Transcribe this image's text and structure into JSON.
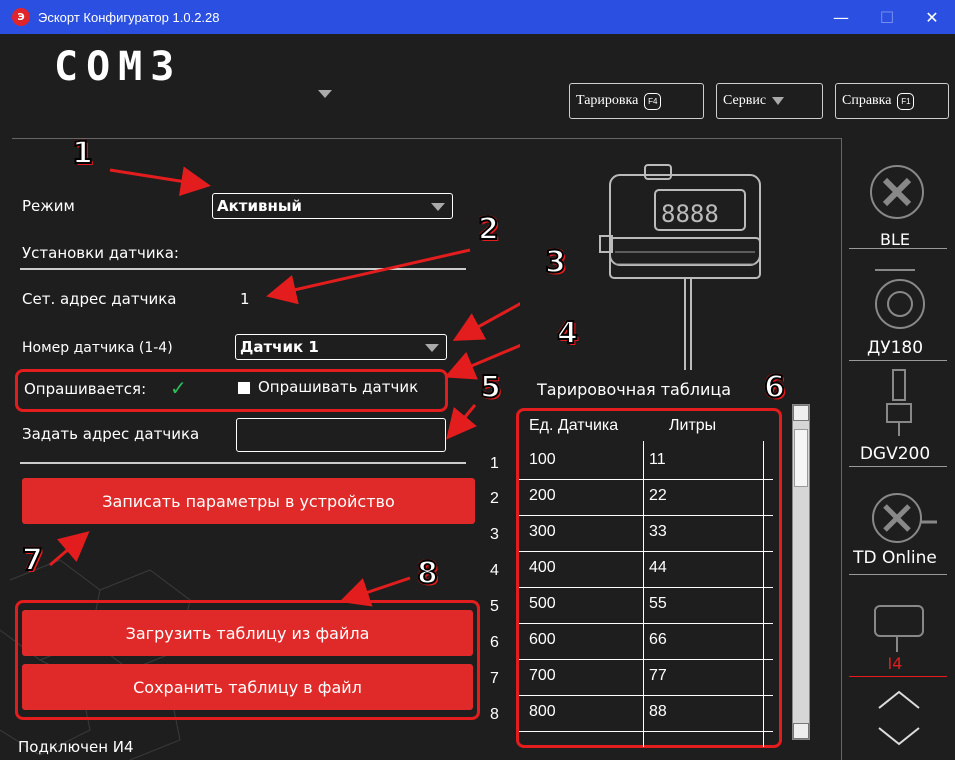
{
  "window": {
    "title": "Эскорт Конфигуратор 1.0.2.28",
    "icon": "app-logo-icon",
    "minimize": "—",
    "maximize": "☐",
    "close": "✕"
  },
  "header": {
    "port": "COM3",
    "buttons": [
      {
        "label": "Тарировка",
        "key": "F4"
      },
      {
        "label": "Сервис"
      },
      {
        "label": "Справка",
        "key": "F1"
      }
    ]
  },
  "form": {
    "mode_label": "Режим",
    "mode_value": "Активный",
    "section_title": "Установки датчика:",
    "net_address_label": "Сет. адрес датчика",
    "net_address_value": "1",
    "sensor_number_label": "Номер датчика (1-4)",
    "sensor_number_value": "Датчик 1",
    "polled_label": "Опрашивается:",
    "polled_mark": "✓",
    "poll_checkbox_label": "Опрашивать датчик",
    "set_address_label": "Задать адрес датчика",
    "set_address_value": "",
    "write_button": "Записать параметры в устройство",
    "load_button": "Загрузить таблицу из файла",
    "save_button": "Сохранить таблицу в файл",
    "status": "Подключен И4"
  },
  "table": {
    "title": "Тарировочная таблица",
    "col_sensor": "Ед. Датчика",
    "col_liters": "Литры",
    "rows": [
      {
        "n": "1",
        "sensor": "100",
        "liters": "11"
      },
      {
        "n": "2",
        "sensor": "200",
        "liters": "22"
      },
      {
        "n": "3",
        "sensor": "300",
        "liters": "33"
      },
      {
        "n": "4",
        "sensor": "400",
        "liters": "44"
      },
      {
        "n": "5",
        "sensor": "500",
        "liters": "55"
      },
      {
        "n": "6",
        "sensor": "600",
        "liters": "66"
      },
      {
        "n": "7",
        "sensor": "700",
        "liters": "77"
      },
      {
        "n": "8",
        "sensor": "800",
        "liters": "88"
      }
    ]
  },
  "sidebar": {
    "items": [
      {
        "label": "BLE",
        "icon": "ble-sensor-icon"
      },
      {
        "label": "ДУ180",
        "icon": "du180-sensor-icon"
      },
      {
        "label": "DGV200",
        "icon": "dgv200-sensor-icon"
      },
      {
        "label": "TD Online",
        "icon": "td-online-sensor-icon"
      },
      {
        "label": "I4",
        "icon": "i4-indicator-icon",
        "active": true
      }
    ],
    "up_icon": "chevron-up-icon",
    "down_icon": "chevron-down-icon"
  },
  "annotations": [
    "1",
    "2",
    "3",
    "4",
    "5",
    "6",
    "7",
    "8"
  ],
  "colors": {
    "accent": "#e02a2a",
    "titlebar": "#2b4fe0",
    "background": "#1e1e1e",
    "active_sidebar": "#e31d1d"
  }
}
